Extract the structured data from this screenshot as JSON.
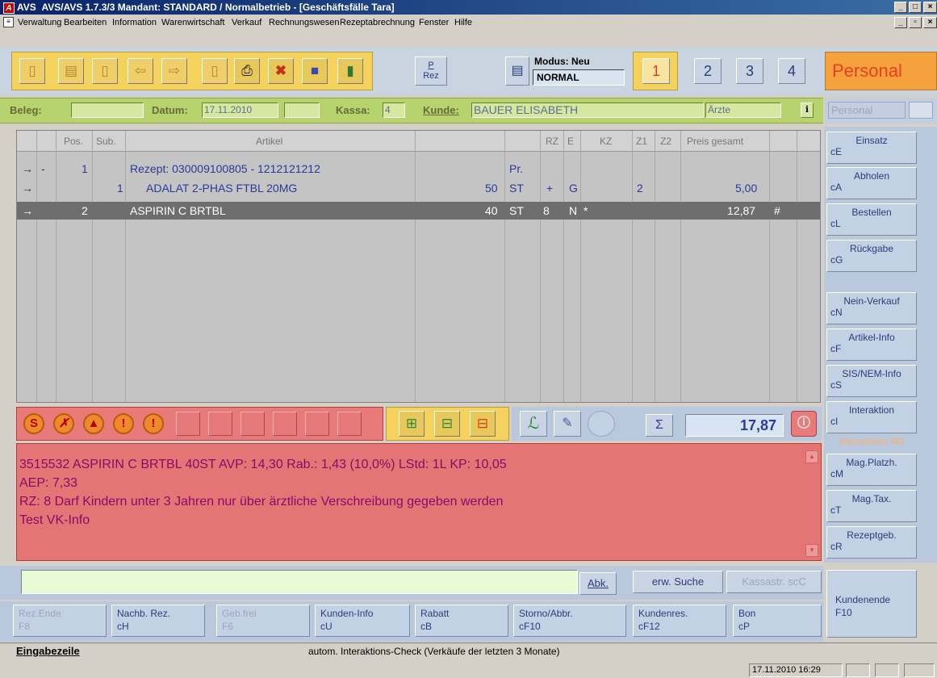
{
  "window": {
    "app": "AVS",
    "title": "AVS/AVS 1.7.3/3   Mandant: STANDARD / Normalbetrieb - [Geschäftsfälle Tara]"
  },
  "menu": [
    "Verwaltung",
    "Bearbeiten",
    "Information",
    "Warenwirtschaft",
    "Verkauf",
    "Rechnungswesen",
    "Rezeptabrechnung",
    "Fenster",
    "Hilfe"
  ],
  "toolbar": {
    "prez_label_1": "P",
    "prez_label_2": "Rez",
    "modus_label": "Modus: Neu",
    "modus_value": "NORMAL",
    "pages": [
      "1",
      "2",
      "3",
      "4"
    ],
    "personal_label": "Personal"
  },
  "beleg": {
    "beleg_label": "Beleg:",
    "beleg_value": "",
    "datum_label": "Datum:",
    "datum_value": "17.11.2010",
    "kassa_label": "Kassa:",
    "kassa_value": "4",
    "kunde_label": "Kunde:",
    "kunde_value": "BAUER ELISABETH",
    "arzte_value": "Ärzte",
    "personal_label": "Personal"
  },
  "grid": {
    "headers": [
      "Pos.",
      "Sub.",
      "Artikel",
      "RZ",
      "E",
      "KZ",
      "Z1",
      "Z2",
      "Preis gesamt"
    ],
    "rows": [
      {
        "arrow": "→",
        "mark": "-",
        "pos": "1",
        "sub": "",
        "artikel": "Rezept: 030009100805 - 1212121212",
        "menge": "",
        "einheit": "Pr.",
        "rz": "",
        "e": "",
        "kz": "",
        "z1": "",
        "z2": "",
        "preis": "",
        "flag": ""
      },
      {
        "arrow": "→",
        "mark": "",
        "pos": "",
        "sub": "1",
        "artikel": "ADALAT 2-PHAS FTBL 20MG",
        "menge": "50",
        "einheit": "ST",
        "rz": "+",
        "e": "G",
        "kz": "",
        "z1": "2",
        "z2": "",
        "preis": "5,00",
        "flag": ""
      },
      {
        "arrow": "→",
        "mark": "",
        "pos": "2",
        "sub": "",
        "artikel": "ASPIRIN C BRTBL",
        "menge": "40",
        "einheit": "ST",
        "rz": "8",
        "e": "N",
        "kz": "*",
        "z1": "",
        "z2": "",
        "preis": "12,87",
        "flag": "#"
      }
    ]
  },
  "sidebar": [
    {
      "label": "Einsatz",
      "key": "cE"
    },
    {
      "label": "Abholen",
      "key": "cA"
    },
    {
      "label": "Bestellen",
      "key": "cL"
    },
    {
      "label": "Rückgabe",
      "key": "cG"
    },
    {
      "label": "Nein-Verkauf",
      "key": "cN"
    },
    {
      "label": "Artikel-Info",
      "key": "cF"
    },
    {
      "label": "SIS/NEM-Info",
      "key": "cS"
    },
    {
      "label": "Interaktion",
      "key": "cI"
    },
    {
      "label": "Interaktion M3",
      "key": ""
    },
    {
      "label": "Mag.Platzh.",
      "key": "cM"
    },
    {
      "label": "Mag.Tax.",
      "key": "cT"
    },
    {
      "label": "Rezeptgeb.",
      "key": "cR"
    }
  ],
  "sum": {
    "symbol": "Σ",
    "value": "17,87"
  },
  "info": [
    "3515532 ASPIRIN C BRTBL    40ST   AVP: 14,30   Rab.: 1,43 (10,0%)   LStd: 1L      KP: 10,05",
    "AEP: 7,33",
    "RZ: 8 Darf Kindern unter 3 Jahren nur über ärztliche Verschreibung gegeben werden",
    "Test VK-Info"
  ],
  "input": {
    "abk": "Abk.",
    "erw_suche": "erw. Suche",
    "kassastr": "Kassastr. scC"
  },
  "bottom_buttons": [
    {
      "label": "Rez.Ende",
      "key": "F8"
    },
    {
      "label": "Nachb. Rez.",
      "key": "cH"
    },
    {
      "label": "Geb.frei",
      "key": "F6"
    },
    {
      "label": "Kunden-Info",
      "key": "cU"
    },
    {
      "label": "Rabatt",
      "key": "cB"
    },
    {
      "label": "Storno/Abbr.",
      "key": "cF10"
    },
    {
      "label": "Kundenres.",
      "key": "cF12"
    },
    {
      "label": "Bon",
      "key": "cP"
    }
  ],
  "kundenende": {
    "label": "Kundenende",
    "key": "F10"
  },
  "status": {
    "left": "Eingabezeile",
    "center": "autom. Interaktions-Check (Verkäufe der letzten 3 Monate)",
    "datetime": "17.11.2010 16:29"
  },
  "colors": {
    "toolbar_yellow": "#f5d25e",
    "beleg_green": "#b7d36e",
    "alert_red": "#e57575",
    "panel_blue": "#b9c8dc",
    "selected_row": "#6e6e6e",
    "sum_blue": "#2b3c9a"
  }
}
